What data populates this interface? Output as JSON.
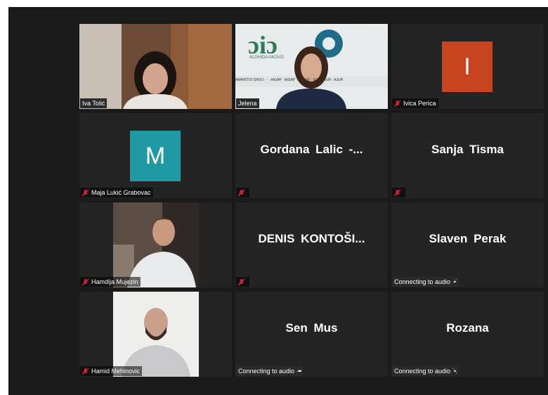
{
  "participants": [
    {
      "name": "Iva Tolić"
    },
    {
      "name": "Jelena",
      "logo_text": "ALGHIDA AKOVO",
      "banner_text": "AMAIRTOI SHOIJ · · · AIGAP · AIGAP · · · SUR · SUR · SUR · AJUR"
    },
    {
      "name": "Ivica Perica",
      "initial": "I",
      "avatar_color": "#c8441e"
    },
    {
      "name": "Maja Lukić Grabovac",
      "initial": "M",
      "avatar_color": "#1f9aa5"
    },
    {
      "name": "Gordana  Lalic -..."
    },
    {
      "name": "Sanja Tisma"
    },
    {
      "name": "Hamdija Mujezin"
    },
    {
      "name": "DENIS  KONTOŠI..."
    },
    {
      "name": "Slaven Perak",
      "status": "Connecting to audio"
    },
    {
      "name": "Hamid Mehinovic"
    },
    {
      "name": "Sen Mus",
      "status": "Connecting to audio"
    },
    {
      "name": "Rozana",
      "status": "Connecting to audio"
    }
  ],
  "icons": {
    "muted": "mic-off-icon",
    "connecting": "loading-dots-icon"
  },
  "colors": {
    "active_speaker": "#c7e46f",
    "tile": "#242424",
    "background": "#1a1a1a",
    "mute": "#e0243a"
  }
}
